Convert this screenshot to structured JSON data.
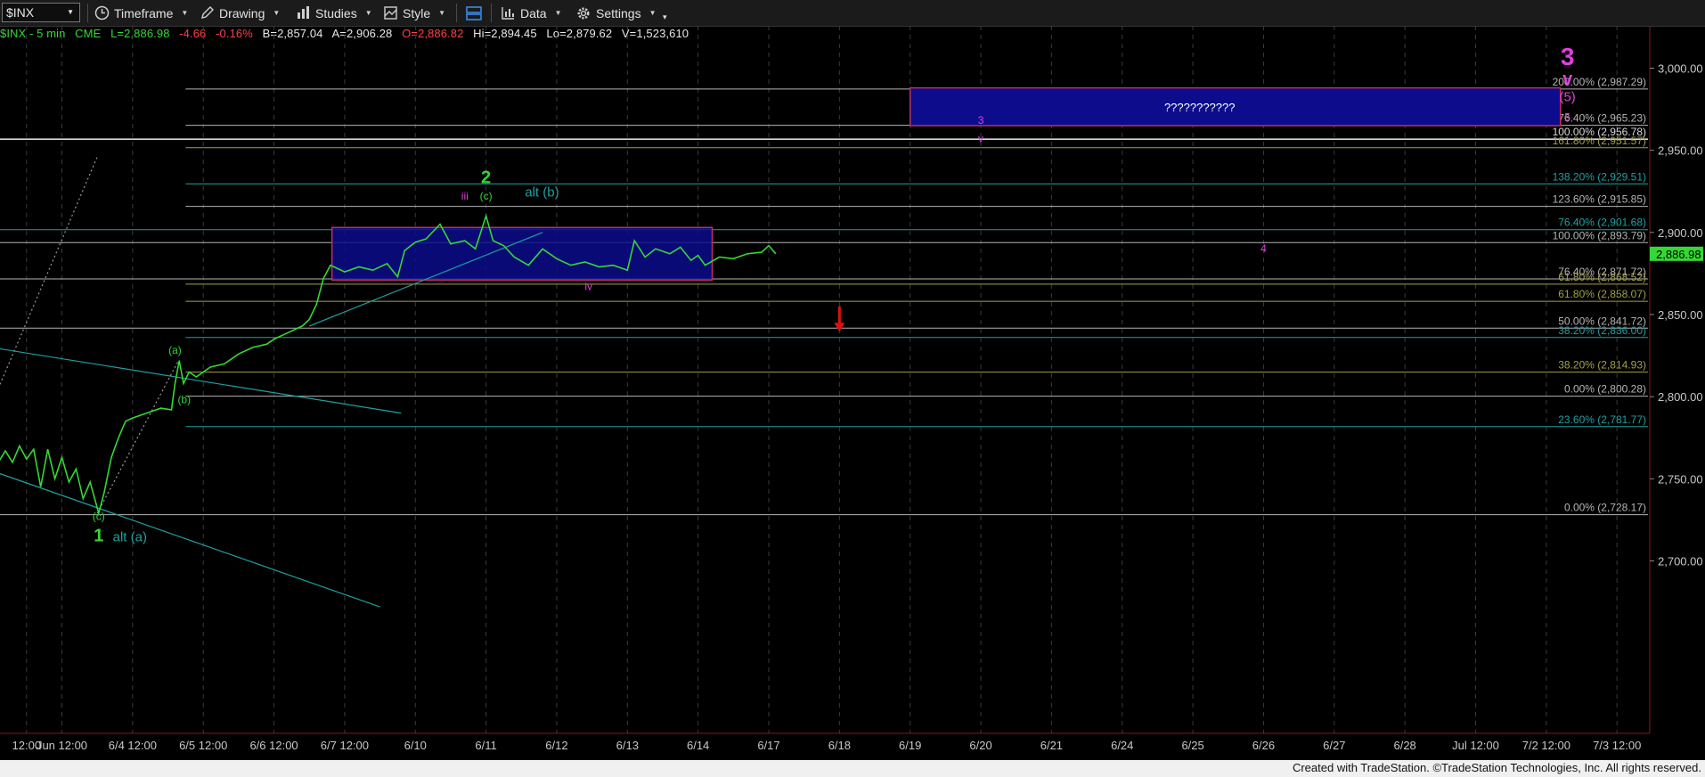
{
  "toolbar": {
    "symbol": "$INX",
    "timeframe_label": "Timeframe",
    "drawing_label": "Drawing",
    "studies_label": "Studies",
    "style_label": "Style",
    "data_label": "Data",
    "settings_label": "Settings"
  },
  "status": {
    "name": "$INX - 5 min",
    "exchange": "CME",
    "last": "L=2,886.98",
    "change": "-4.66",
    "pct": "-0.16%",
    "bid": "B=2,857.04",
    "ask": "A=2,906.28",
    "open": "O=2,886.82",
    "high": "Hi=2,894.45",
    "low": "Lo=2,879.62",
    "volume": "V=1,523,610"
  },
  "footer": "Created with TradeStation. ©TradeStation Technologies, Inc. All rights reserved.",
  "colors": {
    "price": "#35d735",
    "magenta": "#e040e0",
    "teal": "#1fa0a0",
    "olive": "#a0a048",
    "box_fill": "#0c0c8c",
    "box_border_upper": "#c03060",
    "box_border_lower": "#8070d0",
    "arrow": "#dd1111",
    "last_price_bg": "#35d735"
  },
  "chart_data": {
    "type": "line",
    "title": "$INX - 5 min",
    "last_price": "2,886.98",
    "y_axis": {
      "range": [
        2670,
        3025
      ],
      "ticks": [
        "3,000.00",
        "2,950.00",
        "2,900.00",
        "2,850.00",
        "2,800.00",
        "2,750.00",
        "2,700.00"
      ],
      "tick_values": [
        3000,
        2950,
        2900,
        2850,
        2800,
        2750,
        2700
      ]
    },
    "x_axis": {
      "labels": [
        "12:00",
        "Jun 12:00",
        "6/4 12:00",
        "6/5 12:00",
        "6/6 12:00",
        "6/7 12:00",
        "6/10",
        "6/11",
        "6/12",
        "6/13",
        "6/14",
        "6/17",
        "6/18",
        "6/19",
        "6/20",
        "6/21",
        "6/24",
        "6/25",
        "6/26",
        "6/27",
        "6/28",
        "Jul 12:00",
        "7/2 12:00",
        "7/3 12:00"
      ],
      "label_index": [
        -0.5,
        0,
        1,
        2,
        3,
        4,
        5,
        6,
        7,
        8,
        9,
        10,
        11,
        12,
        13,
        14,
        15,
        16,
        17,
        18,
        19,
        20,
        21,
        22
      ]
    },
    "series": [
      {
        "values": [
          {
            "t": -0.9,
            "v": 2760
          },
          {
            "t": -0.8,
            "v": 2767
          },
          {
            "t": -0.7,
            "v": 2760
          },
          {
            "t": -0.6,
            "v": 2770
          },
          {
            "t": -0.5,
            "v": 2762
          },
          {
            "t": -0.4,
            "v": 2768
          },
          {
            "t": -0.3,
            "v": 2745
          },
          {
            "t": -0.2,
            "v": 2768
          },
          {
            "t": -0.1,
            "v": 2750
          },
          {
            "t": 0.0,
            "v": 2763
          },
          {
            "t": 0.1,
            "v": 2748
          },
          {
            "t": 0.2,
            "v": 2756
          },
          {
            "t": 0.3,
            "v": 2738
          },
          {
            "t": 0.4,
            "v": 2748
          },
          {
            "t": 0.52,
            "v": 2729
          },
          {
            "t": 0.6,
            "v": 2742
          },
          {
            "t": 0.7,
            "v": 2763
          },
          {
            "t": 0.8,
            "v": 2775
          },
          {
            "t": 0.9,
            "v": 2785
          },
          {
            "t": 1.0,
            "v": 2787
          },
          {
            "t": 1.2,
            "v": 2790
          },
          {
            "t": 1.4,
            "v": 2793
          },
          {
            "t": 1.55,
            "v": 2792
          },
          {
            "t": 1.6,
            "v": 2808
          },
          {
            "t": 1.66,
            "v": 2822
          },
          {
            "t": 1.72,
            "v": 2808
          },
          {
            "t": 1.8,
            "v": 2815
          },
          {
            "t": 1.9,
            "v": 2812
          },
          {
            "t": 2.1,
            "v": 2818
          },
          {
            "t": 2.3,
            "v": 2820
          },
          {
            "t": 2.5,
            "v": 2826
          },
          {
            "t": 2.7,
            "v": 2830
          },
          {
            "t": 2.9,
            "v": 2832
          },
          {
            "t": 3.0,
            "v": 2835
          },
          {
            "t": 3.2,
            "v": 2839
          },
          {
            "t": 3.4,
            "v": 2843
          },
          {
            "t": 3.5,
            "v": 2847
          },
          {
            "t": 3.6,
            "v": 2856
          },
          {
            "t": 3.7,
            "v": 2872
          },
          {
            "t": 3.8,
            "v": 2880
          },
          {
            "t": 4.0,
            "v": 2876
          },
          {
            "t": 4.2,
            "v": 2879
          },
          {
            "t": 4.4,
            "v": 2877
          },
          {
            "t": 4.6,
            "v": 2881
          },
          {
            "t": 4.75,
            "v": 2873
          },
          {
            "t": 4.85,
            "v": 2889
          },
          {
            "t": 5.0,
            "v": 2894
          },
          {
            "t": 5.15,
            "v": 2896
          },
          {
            "t": 5.35,
            "v": 2905
          },
          {
            "t": 5.5,
            "v": 2893
          },
          {
            "t": 5.7,
            "v": 2895
          },
          {
            "t": 5.85,
            "v": 2890
          },
          {
            "t": 6.0,
            "v": 2910
          },
          {
            "t": 6.1,
            "v": 2895
          },
          {
            "t": 6.25,
            "v": 2892
          },
          {
            "t": 6.4,
            "v": 2885
          },
          {
            "t": 6.6,
            "v": 2880
          },
          {
            "t": 6.8,
            "v": 2890
          },
          {
            "t": 7.0,
            "v": 2884
          },
          {
            "t": 7.2,
            "v": 2880
          },
          {
            "t": 7.4,
            "v": 2882
          },
          {
            "t": 7.6,
            "v": 2879
          },
          {
            "t": 7.8,
            "v": 2880
          },
          {
            "t": 8.0,
            "v": 2877
          },
          {
            "t": 8.1,
            "v": 2895
          },
          {
            "t": 8.25,
            "v": 2885
          },
          {
            "t": 8.4,
            "v": 2890
          },
          {
            "t": 8.6,
            "v": 2887
          },
          {
            "t": 8.75,
            "v": 2891
          },
          {
            "t": 8.9,
            "v": 2883
          },
          {
            "t": 9.0,
            "v": 2886
          },
          {
            "t": 9.1,
            "v": 2880
          },
          {
            "t": 9.3,
            "v": 2885
          },
          {
            "t": 9.5,
            "v": 2884
          },
          {
            "t": 9.7,
            "v": 2887
          },
          {
            "t": 9.9,
            "v": 2888
          },
          {
            "t": 10.0,
            "v": 2892
          },
          {
            "t": 10.1,
            "v": 2886.98
          }
        ]
      }
    ],
    "fib_levels": [
      {
        "label": "200.00% (2,987.29)",
        "value": 2987.29,
        "color": "gray"
      },
      {
        "label": "176.40% (2,965.23)",
        "value": 2965.23,
        "color": "gray"
      },
      {
        "label": "100.00% (2,956.78)",
        "value": 2956.78,
        "color": "white"
      },
      {
        "label": "161.80% (2,951.57)",
        "value": 2951.57,
        "color": "olive"
      },
      {
        "label": "138.20% (2,929.51)",
        "value": 2929.51,
        "color": "teal"
      },
      {
        "label": "123.60% (2,915.85)",
        "value": 2915.85,
        "color": "gray"
      },
      {
        "label": "76.40% (2,901.68)",
        "value": 2901.68,
        "color": "teal"
      },
      {
        "label": "100.00% (2,893.79)",
        "value": 2893.79,
        "color": "gray"
      },
      {
        "label": "76.40% (2,871.72)",
        "value": 2871.72,
        "color": "gray"
      },
      {
        "label": "61.80% (2,868.52)",
        "value": 2868.52,
        "color": "olive"
      },
      {
        "label": "61.80% (2,858.07)",
        "value": 2858.07,
        "color": "olive"
      },
      {
        "label": "50.00% (2,841.72)",
        "value": 2841.72,
        "color": "gray"
      },
      {
        "label": "38.20% (2,836.00)",
        "value": 2836.0,
        "color": "teal"
      },
      {
        "label": "38.20% (2,814.93)",
        "value": 2814.93,
        "color": "olive"
      },
      {
        "label": "0.00% (2,800.28)",
        "value": 2800.28,
        "color": "gray"
      },
      {
        "label": "23.60% (2,781.77)",
        "value": 2781.77,
        "color": "teal"
      },
      {
        "label": "0.00% (2,728.17)",
        "value": 2728.17,
        "color": "gray"
      }
    ],
    "boxes": [
      {
        "t0": 3.82,
        "t1": 9.2,
        "v0": 2903,
        "v1": 2871,
        "label": ""
      },
      {
        "t0": 12.0,
        "t1": 21.2,
        "v0": 2988,
        "v1": 2965,
        "label": "???????????"
      }
    ],
    "wave_labels": [
      {
        "text": "3",
        "t": 21.3,
        "v": 3002,
        "color": "magenta",
        "size": "xl"
      },
      {
        "text": "v",
        "t": 21.3,
        "v": 2990,
        "color": "magenta",
        "size": "l"
      },
      {
        "text": "(5)",
        "t": 21.3,
        "v": 2980,
        "color": "magenta",
        "size": "m"
      },
      {
        "text": "5",
        "t": 21.3,
        "v": 2968,
        "color": "magenta",
        "size": "s"
      },
      {
        "text": "3",
        "t": 13.0,
        "v": 2966,
        "color": "magenta",
        "size": "s"
      },
      {
        "text": "v",
        "t": 13.0,
        "v": 2955,
        "color": "magenta",
        "size": "s"
      },
      {
        "text": "2",
        "t": 6.0,
        "v": 2930,
        "color": "green",
        "size": "l"
      },
      {
        "text": "(c)",
        "t": 6.0,
        "v": 2920,
        "color": "green",
        "size": "s"
      },
      {
        "text": "alt (b)",
        "t": 6.55,
        "v": 2922,
        "color": "teal",
        "size": "m"
      },
      {
        "text": "iii",
        "t": 5.7,
        "v": 2920,
        "color": "magenta",
        "size": "s"
      },
      {
        "text": "iv",
        "t": 7.45,
        "v": 2865,
        "color": "magenta",
        "size": "s"
      },
      {
        "text": "4",
        "t": 17.0,
        "v": 2888,
        "color": "magenta",
        "size": "s"
      },
      {
        "text": "(a)",
        "t": 1.6,
        "v": 2826,
        "color": "green",
        "size": "s"
      },
      {
        "text": "(b)",
        "t": 1.73,
        "v": 2796,
        "color": "green",
        "size": "s"
      },
      {
        "text": "(c)",
        "t": 0.52,
        "v": 2725,
        "color": "green",
        "size": "s"
      },
      {
        "text": "1",
        "t": 0.52,
        "v": 2712,
        "color": "green",
        "size": "l"
      },
      {
        "text": "alt (a)",
        "t": 0.72,
        "v": 2712,
        "color": "teal",
        "size": "m"
      }
    ],
    "trendlines": [
      {
        "t0": -1.0,
        "v0": 2830,
        "t1": 4.8,
        "v1": 2790,
        "color": "teal"
      },
      {
        "t0": -1.0,
        "v0": 2755,
        "t1": 4.5,
        "v1": 2672,
        "color": "teal"
      },
      {
        "t0": 3.5,
        "v0": 2843,
        "t1": 6.8,
        "v1": 2900,
        "color": "teal"
      },
      {
        "t0": -1.0,
        "v0": 2795,
        "t1": 0.5,
        "v1": 2946,
        "color": "dotted"
      },
      {
        "t0": 0.5,
        "v0": 2729,
        "t1": 1.65,
        "v1": 2822,
        "color": "dotted"
      }
    ],
    "arrow": {
      "t": 11.0,
      "v_top": 2855,
      "v_bottom": 2845,
      "direction": "down"
    },
    "grid": true
  }
}
